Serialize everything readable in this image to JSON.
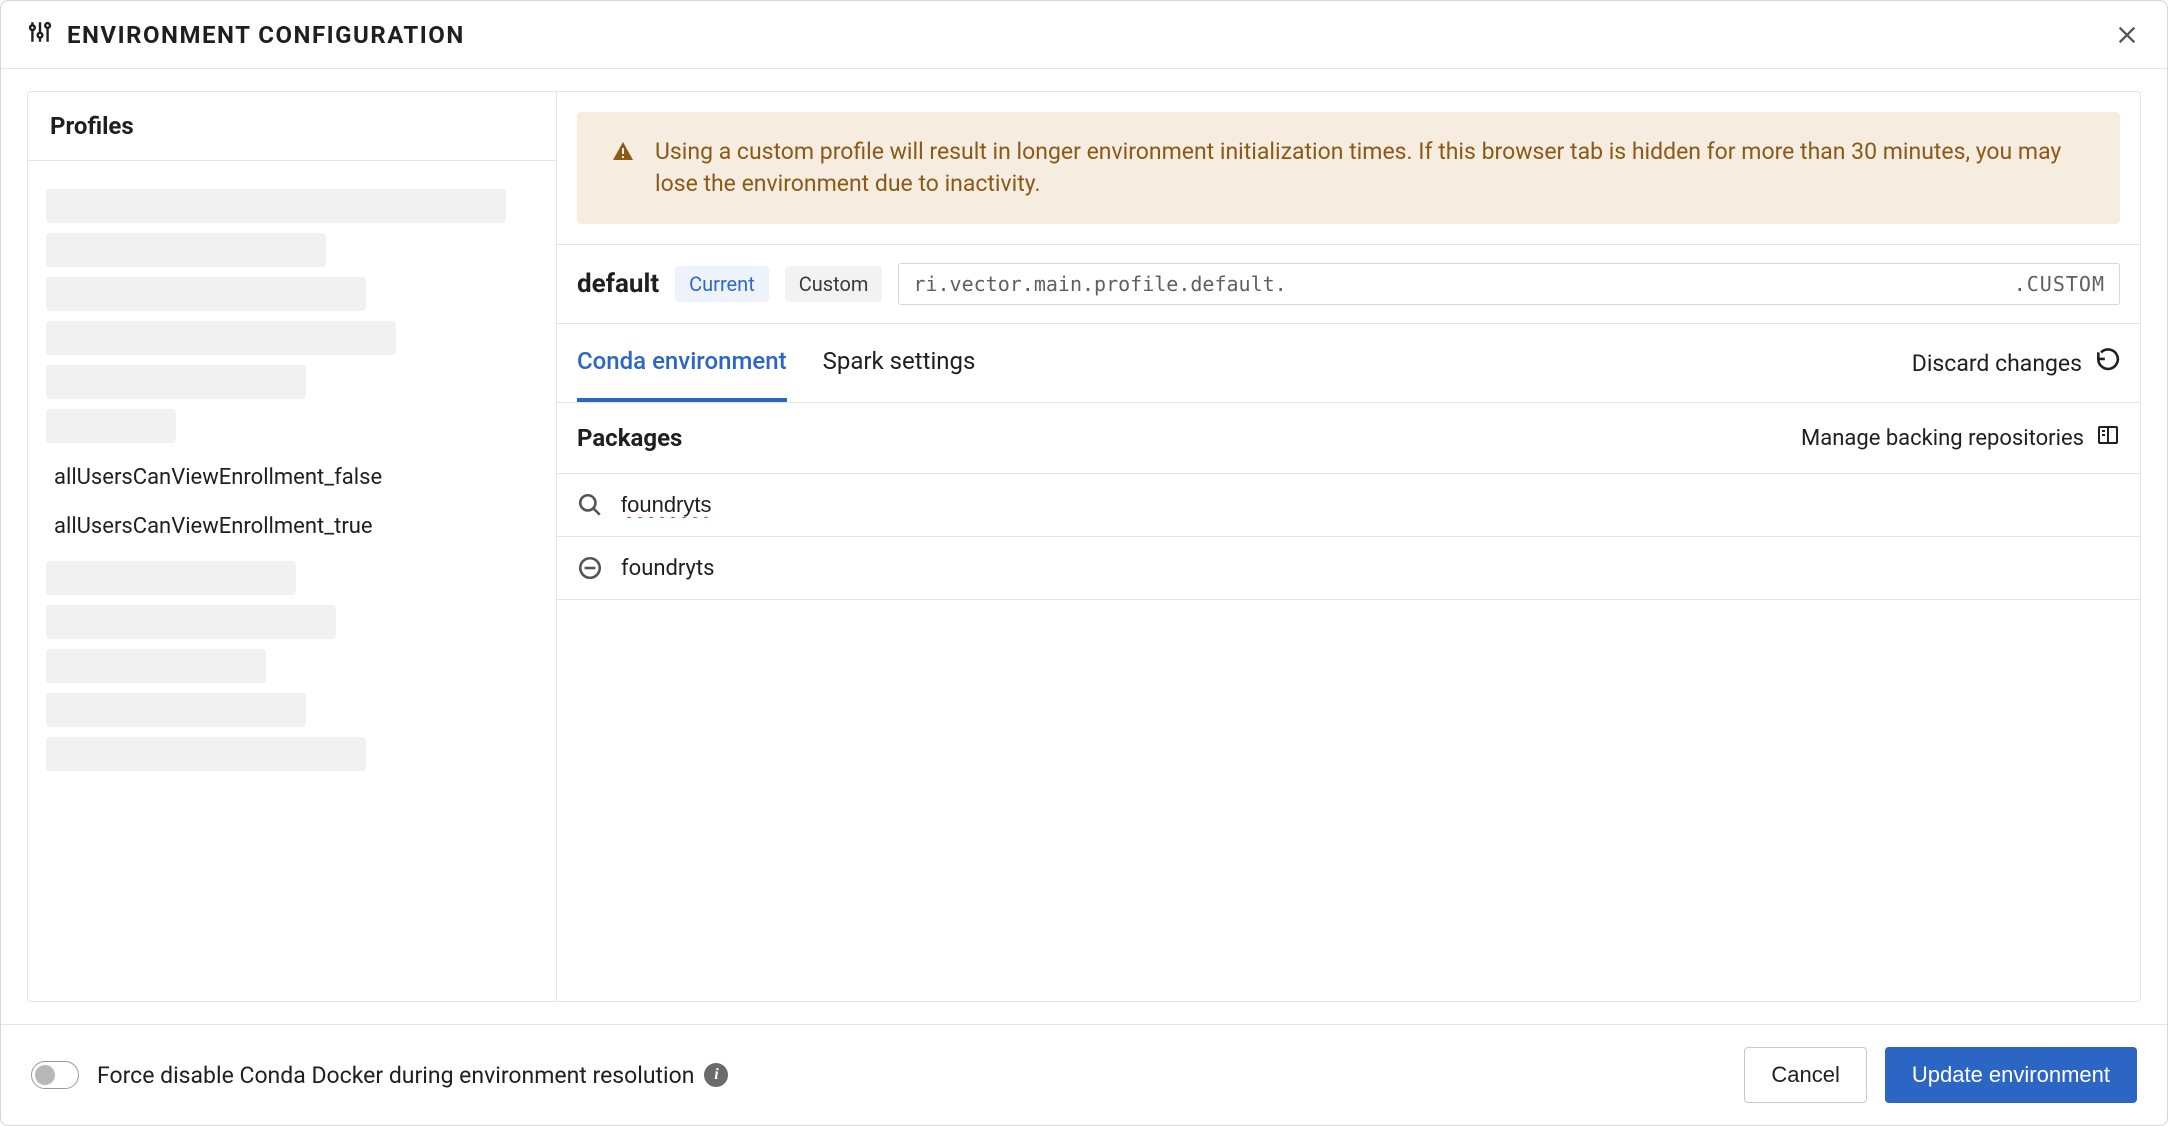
{
  "header": {
    "title": "ENVIRONMENT CONFIGURATION"
  },
  "sidebar": {
    "title": "Profiles",
    "redacted_before": 6,
    "items": [
      {
        "label": "allUsersCanViewEnrollment_false",
        "selected": false
      },
      {
        "label": "allUsersCanViewEnrollment_true",
        "selected": false
      }
    ],
    "redacted_after": 5
  },
  "warning": {
    "text": "Using a custom profile will result in longer environment initialization times. If this browser tab is hidden for more than 30 minutes, you may lose the environment due to inactivity."
  },
  "profile": {
    "name": "default",
    "badge_current": "Current",
    "badge_custom": "Custom",
    "id_prefix": "ri.vector.main.profile.default.",
    "id_suffix": ".CUSTOM"
  },
  "tabs": {
    "items": [
      {
        "label": "Conda environment",
        "active": true
      },
      {
        "label": "Spark settings",
        "active": false
      }
    ],
    "discard_label": "Discard changes"
  },
  "packages": {
    "title": "Packages",
    "manage_repos_label": "Manage backing repositories",
    "search_value": "foundryts",
    "results": [
      {
        "name": "foundryts"
      }
    ]
  },
  "footer": {
    "toggle_label": "Force disable Conda Docker during environment resolution",
    "toggle_on": false,
    "cancel_label": "Cancel",
    "update_label": "Update environment"
  },
  "redacted_widths": [
    460,
    280,
    320,
    350,
    260,
    130,
    250,
    290,
    220,
    260,
    320
  ]
}
